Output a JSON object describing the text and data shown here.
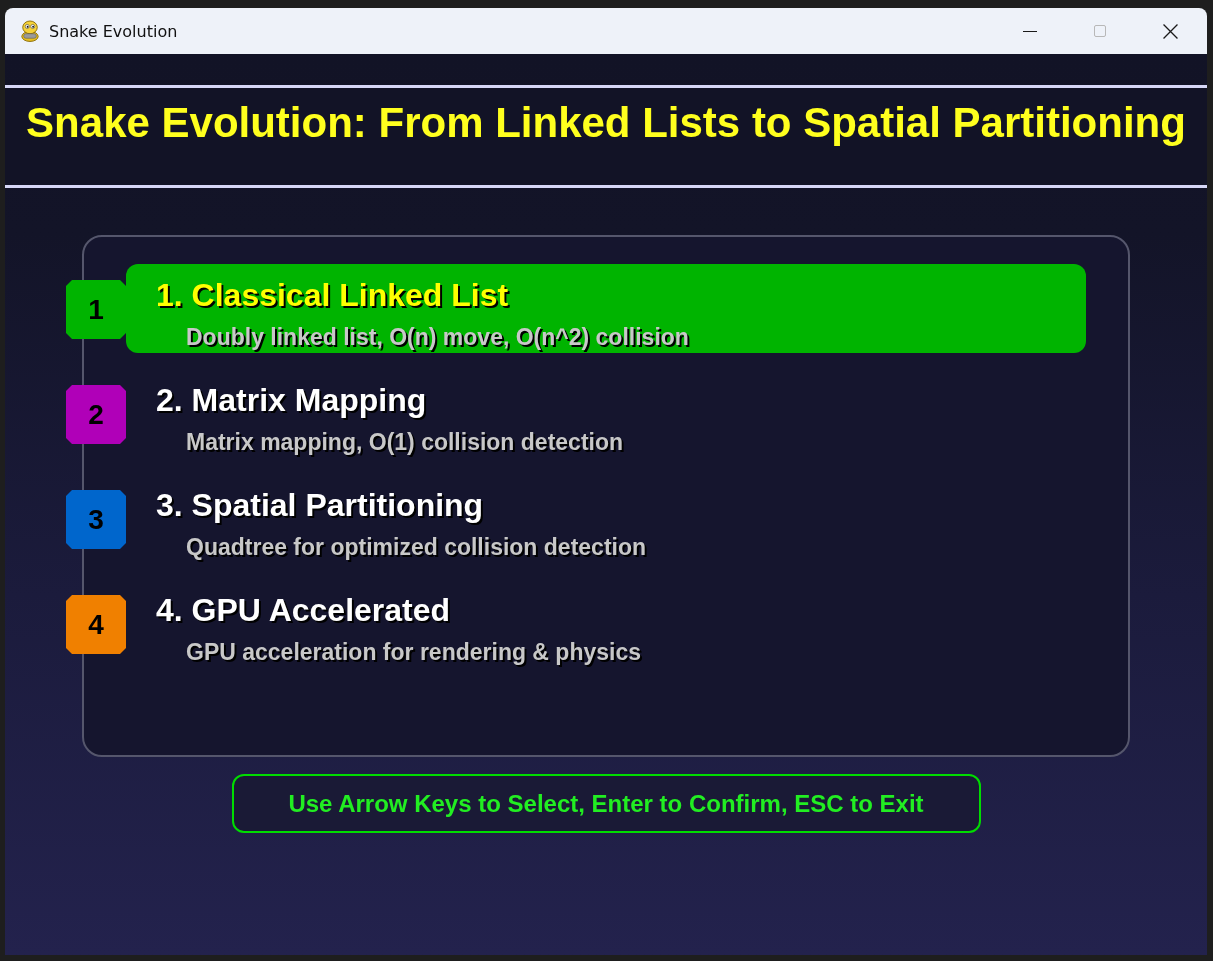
{
  "window": {
    "title": "Snake Evolution",
    "controls": [
      {
        "kind": "minimize",
        "disabled": false
      },
      {
        "kind": "maximize",
        "disabled": true
      },
      {
        "kind": "close",
        "disabled": false
      }
    ]
  },
  "heading": "Snake Evolution: From Linked Lists to Spatial Partitioning",
  "menu": {
    "items": [
      {
        "number": "1",
        "title": "1. Classical Linked List",
        "description": "Doubly linked list, O(n) move, O(n^2) collision",
        "color": "#00b400",
        "selected": true
      },
      {
        "number": "2",
        "title": "2. Matrix Mapping",
        "description": "Matrix mapping, O(1) collision detection",
        "color": "#b000b8",
        "selected": false
      },
      {
        "number": "3",
        "title": "3. Spatial Partitioning",
        "description": "Quadtree for optimized collision detection",
        "color": "#0066cc",
        "selected": false
      },
      {
        "number": "4",
        "title": "4. GPU Accelerated",
        "description": "GPU acceleration for rendering & physics",
        "color": "#f08000",
        "selected": false
      }
    ]
  },
  "hint": "Use Arrow Keys to Select, Enter to Confirm, ESC to Exit"
}
